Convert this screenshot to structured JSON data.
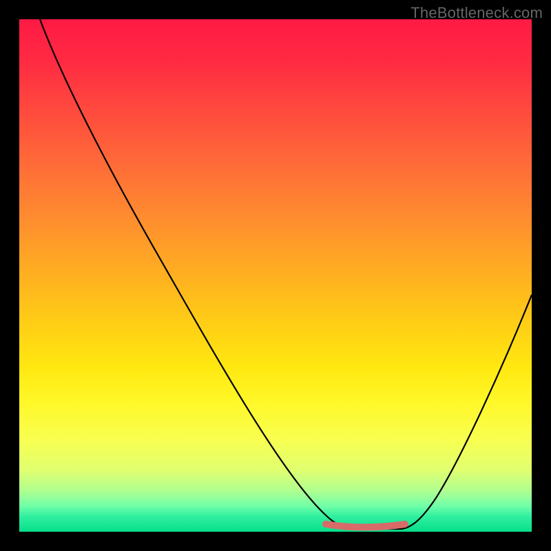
{
  "watermark_text": "TheBottleneck.com",
  "chart_data": {
    "type": "line",
    "title": "",
    "xlabel": "",
    "ylabel": "",
    "xlim": [
      0,
      100
    ],
    "ylim": [
      0,
      100
    ],
    "grid": false,
    "series": [
      {
        "name": "curve",
        "x": [
          4,
          10,
          20,
          30,
          40,
          50,
          58,
          62,
          66,
          70,
          74,
          80,
          88,
          96,
          100
        ],
        "y": [
          100,
          89,
          72,
          55,
          38,
          21,
          8,
          3,
          1,
          0,
          0,
          4,
          18,
          38,
          50
        ]
      }
    ],
    "flat_segment": {
      "x_start": 58,
      "x_end": 76,
      "y": 1
    },
    "gradient_stops": [
      {
        "offset": 0,
        "color": "#ff1a44"
      },
      {
        "offset": 50,
        "color": "#ffb020"
      },
      {
        "offset": 75,
        "color": "#fff82a"
      },
      {
        "offset": 95,
        "color": "#70ffa8"
      },
      {
        "offset": 100,
        "color": "#06df8a"
      }
    ]
  }
}
